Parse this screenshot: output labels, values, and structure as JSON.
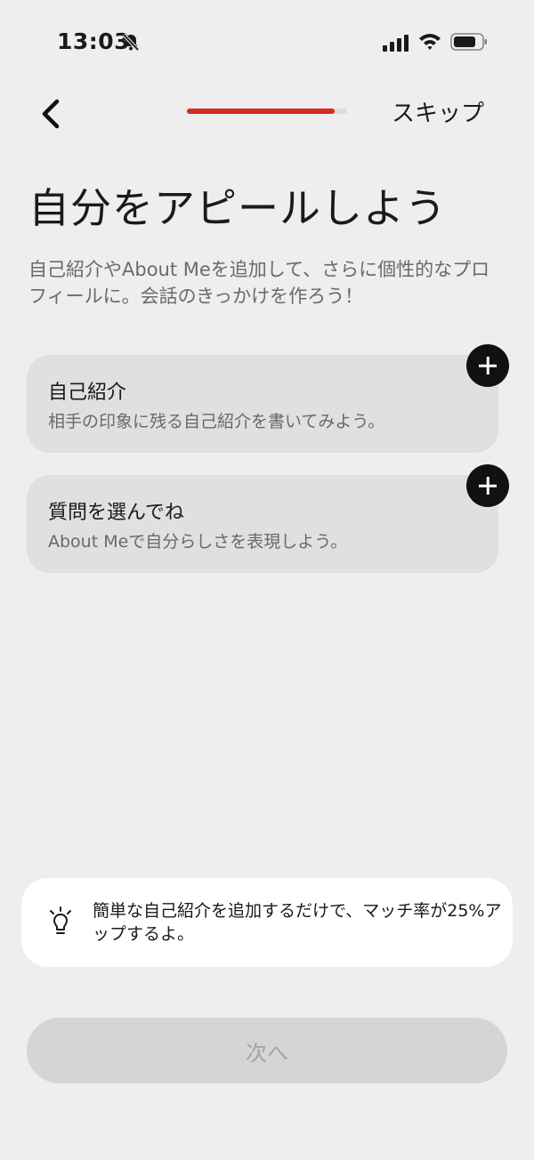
{
  "status_bar": {
    "time": "13:03"
  },
  "nav": {
    "skip_label": "スキップ",
    "progress_fraction": 0.92,
    "progress_color": "#d42a22"
  },
  "header": {
    "title": "自分をアピールしよう",
    "subtitle": "自己紹介やAbout Meを追加して、さらに個性的なプロフィールに。会話のきっかけを作ろう！"
  },
  "cards": [
    {
      "title": "自己紹介",
      "description": "相手の印象に残る自己紹介を書いてみよう。"
    },
    {
      "title": "質問を選んでね",
      "description": "About Meで自分らしさを表現しよう。"
    }
  ],
  "tip": {
    "icon": "lightbulb-icon",
    "text": "簡単な自己紹介を追加するだけで、マッチ率が25%アップするよ。"
  },
  "footer": {
    "next_label": "次へ"
  }
}
